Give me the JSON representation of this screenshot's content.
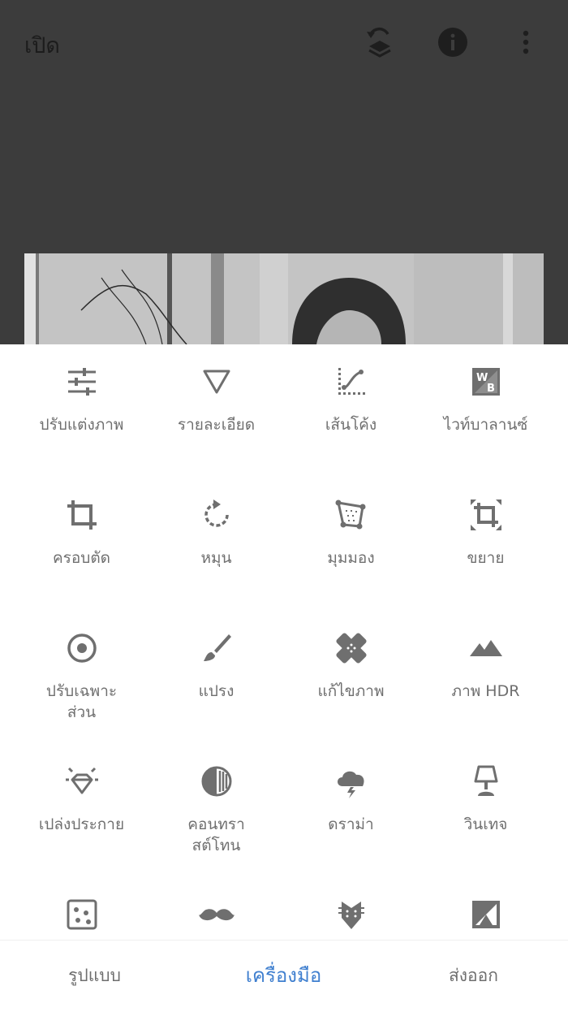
{
  "header": {
    "open_label": "เปิด",
    "icons": [
      "undo-stack-icon",
      "info-icon",
      "more-vert-icon"
    ]
  },
  "tools": [
    {
      "label": "ปรับแต่งภาพ",
      "icon": "tune-icon"
    },
    {
      "label": "รายละเอียด",
      "icon": "details-triangle-icon"
    },
    {
      "label": "เส้นโค้ง",
      "icon": "curves-icon"
    },
    {
      "label": "ไวท์บาลานซ์",
      "icon": "white-balance-icon"
    },
    {
      "label": "ครอบตัด",
      "icon": "crop-icon"
    },
    {
      "label": "หมุน",
      "icon": "rotate-icon"
    },
    {
      "label": "มุมมอง",
      "icon": "perspective-icon"
    },
    {
      "label": "ขยาย",
      "icon": "expand-icon"
    },
    {
      "label": "ปรับเฉพาะ\nส่วน",
      "icon": "selective-icon"
    },
    {
      "label": "แปรง",
      "icon": "brush-icon"
    },
    {
      "label": "แก้ไขภาพ",
      "icon": "healing-icon"
    },
    {
      "label": "ภาพ HDR",
      "icon": "hdr-mountains-icon"
    },
    {
      "label": "เปล่งประกาย",
      "icon": "glamour-glow-icon"
    },
    {
      "label": "คอนทรา\nสต์โทน",
      "icon": "tonal-contrast-icon"
    },
    {
      "label": "ดราม่า",
      "icon": "drama-cloud-icon"
    },
    {
      "label": "วินเทจ",
      "icon": "vintage-lamp-icon"
    },
    {
      "label": "",
      "icon": "grainy-film-icon"
    },
    {
      "label": "",
      "icon": "retrolux-mustache-icon"
    },
    {
      "label": "",
      "icon": "grunge-guitar-icon"
    },
    {
      "label": "",
      "icon": "black-white-icon"
    }
  ],
  "bottom_nav": {
    "styles": "รูปแบบ",
    "tools": "เครื่องมือ",
    "export": "ส่งออก",
    "active": "tools"
  },
  "colors": {
    "topbar": "#3c3c3c",
    "icon": "#6f6f6f",
    "accent": "#3f7fcf"
  }
}
